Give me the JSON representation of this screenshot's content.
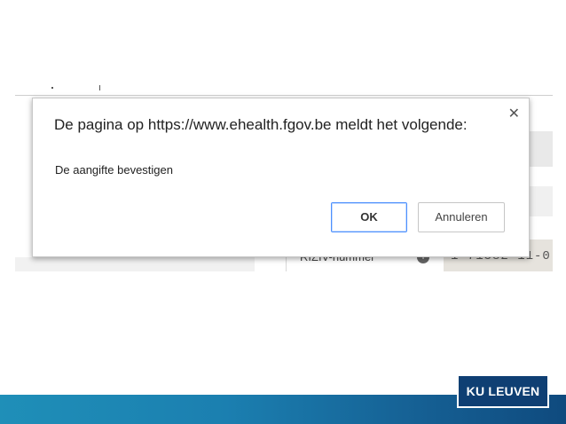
{
  "background_page": {
    "field_label": "RIZIV-nummer",
    "field_value": "1-71582-11-0"
  },
  "dialog": {
    "title": "De pagina op https://www.ehealth.fgov.be meldt het volgende:",
    "message": "De aangifte bevestigen",
    "ok_label": "OK",
    "cancel_label": "Annuleren",
    "close_icon": "close-icon"
  },
  "footer": {
    "logo_text": "KU LEUVEN",
    "colors": {
      "band_start": "#1f8fb8",
      "band_end": "#0f4a7e",
      "logo_bg": "#0f3f73"
    }
  }
}
